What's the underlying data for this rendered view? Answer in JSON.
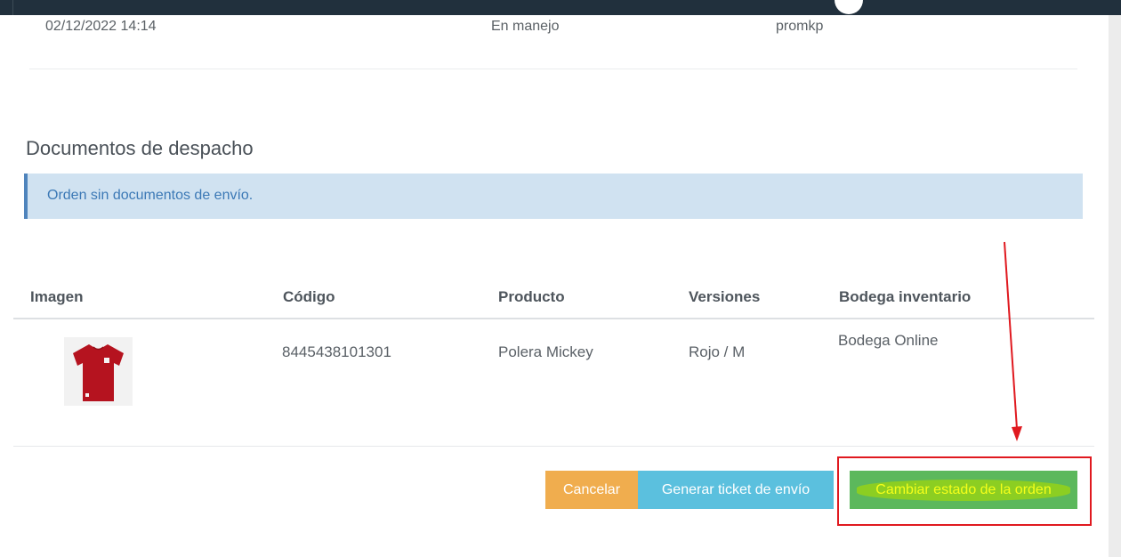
{
  "history": {
    "date": "02/12/2022 14:14",
    "status": "En manejo",
    "user": "promkp"
  },
  "dispatch": {
    "title": "Documentos de despacho",
    "alert": "Orden sin documentos de envío."
  },
  "table": {
    "headers": [
      "Imagen",
      "Código",
      "Producto",
      "Versiones",
      "Bodega inventario"
    ],
    "rows": [
      {
        "image": "red-tshirt-image",
        "codigo": "8445438101301",
        "producto": "Polera Mickey",
        "version": "Rojo / M",
        "bodega": "Bodega Online"
      }
    ]
  },
  "actions": {
    "cancel": "Cancelar",
    "ticket": "Generar ticket de envío",
    "change_status": "Cambiar estado de la orden"
  },
  "colors": {
    "cancel": "#f0ad4e",
    "ticket": "#5bc0de",
    "change_status": "#5cb85c",
    "annotation": "#e0191f",
    "alert_bg": "#d0e2f1",
    "topbar": "#21303d"
  }
}
